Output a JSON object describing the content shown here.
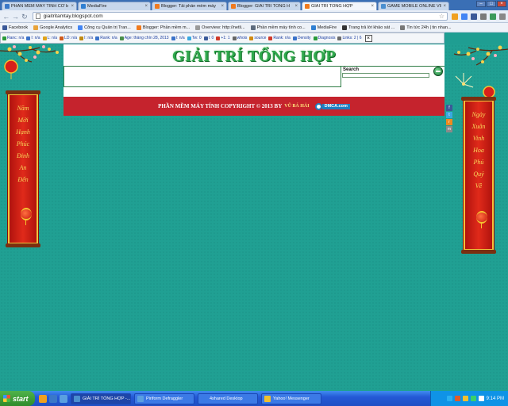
{
  "browser": {
    "tabs": [
      {
        "label": "PHẦN MỀM MÁY TÍNH CƠ b",
        "icon_color": "#3a78c8",
        "active": false
      },
      {
        "label": "MediaFire",
        "icon_color": "#2f7fd2",
        "active": false
      },
      {
        "label": "Blogger: Tải phần mềm máy",
        "icon_color": "#f07a1e",
        "active": false
      },
      {
        "label": "Blogger: GIẢI TRÍ TỔNG H",
        "icon_color": "#f07a1e",
        "active": false
      },
      {
        "label": "GIẢI TRÍ TỔNG HỢP",
        "icon_color": "#f07a1e",
        "active": true
      },
      {
        "label": "GAME MOBILE ONLINE VIỆ",
        "icon_color": "#4a8fd0",
        "active": false
      }
    ],
    "close_glyph": "×",
    "url": "giaitritamtay.blogspot.com",
    "bookmarks": [
      {
        "label": "Facebook",
        "icon_color": "#3b5998"
      },
      {
        "label": "Google Analytics",
        "icon_color": "#e8a33a"
      },
      {
        "label": "Công cụ Quản trị Tran...",
        "icon_color": "#4285f4"
      },
      {
        "label": "Blogger: Phần mềm m...",
        "icon_color": "#f07a1e"
      },
      {
        "label": "Overview: http://netli...",
        "icon_color": "#9a9a9a"
      },
      {
        "label": "Phần mềm máy tính co...",
        "icon_color": "#5d6b7d"
      },
      {
        "label": "MediaFire",
        "icon_color": "#2f7fd2"
      },
      {
        "label": "Trang trả lời khảo sát ...",
        "icon_color": "#333333"
      },
      {
        "label": "Tin tức 24h | tin nhan...",
        "icon_color": "#777777"
      }
    ],
    "seo_items": [
      {
        "text": "Ranc: n/a",
        "icon_color": "#2a9a3a"
      },
      {
        "text": "I: n/a",
        "icon_color": "#3a72c9"
      },
      {
        "text": "L: n/a",
        "icon_color": "#e0a31a"
      },
      {
        "text": "LD: n/a",
        "icon_color": "#d05a1a"
      },
      {
        "text": "I: n/a",
        "icon_color": "#c08a10"
      },
      {
        "text": "Rank: n/a",
        "icon_color": "#3a72c9"
      },
      {
        "text": "Age: tháng chín 28, 2013",
        "icon_color": "#4a8f4a"
      },
      {
        "text": "I: n/a",
        "icon_color": "#3a72c9"
      },
      {
        "text": "Tw: 0",
        "icon_color": "#39a9e0"
      },
      {
        "text": "l: 0",
        "icon_color": "#3a5a99"
      },
      {
        "text": "+1: 1",
        "icon_color": "#d03a2a"
      },
      {
        "text": "whois",
        "icon_color": "#666666"
      },
      {
        "text": "source",
        "icon_color": "#d08a10"
      },
      {
        "text": "Rank: n/a",
        "icon_color": "#d03a2a"
      },
      {
        "text": "Density",
        "icon_color": "#3a72c9"
      },
      {
        "text": "Diagnosis",
        "icon_color": "#2a9a3a"
      },
      {
        "text": "Links: 2 | 6",
        "icon_color": "#6a6a6a"
      }
    ]
  },
  "page": {
    "site_title": "GIẢI TRÍ TỔNG HỢP",
    "search_label": "Search",
    "footer_text": "PHẦN MỀM MÁY TÍNH COPYRIGHT © 2013 BY",
    "footer_author": "VŨ BÁ HẢI",
    "dmca_label": "DMCA.com",
    "banner_left": [
      "Năm",
      "Mới",
      "Hạnh",
      "Phúc",
      "Đinh",
      "An",
      "Đến"
    ],
    "banner_right": [
      "Ngày",
      "Xuân",
      "Vinh",
      "Hoa",
      "Phú",
      "Quý",
      "Về"
    ],
    "social": [
      {
        "letter": "f",
        "color": "#3b5998"
      },
      {
        "letter": "t",
        "color": "#39a9e0"
      },
      {
        "letter": "r",
        "color": "#f08a1e"
      },
      {
        "letter": "m",
        "color": "#8a8a8a"
      }
    ]
  },
  "taskbar": {
    "start_label": "start",
    "tasks": [
      {
        "label": "GIẢI TRÍ TỔNG HỢP -...",
        "icon_color": "#4a8fd0",
        "active": true
      },
      {
        "label": "Piriform Defraggler",
        "icon_color": "#5aa0e0",
        "active": false
      },
      {
        "label": "4shared Desktop",
        "icon_color": "#3a7ae6",
        "active": false
      },
      {
        "label": "Yahoo! Messenger",
        "icon_color": "#f0c030",
        "active": false
      }
    ],
    "clock": "9:14 PM"
  }
}
